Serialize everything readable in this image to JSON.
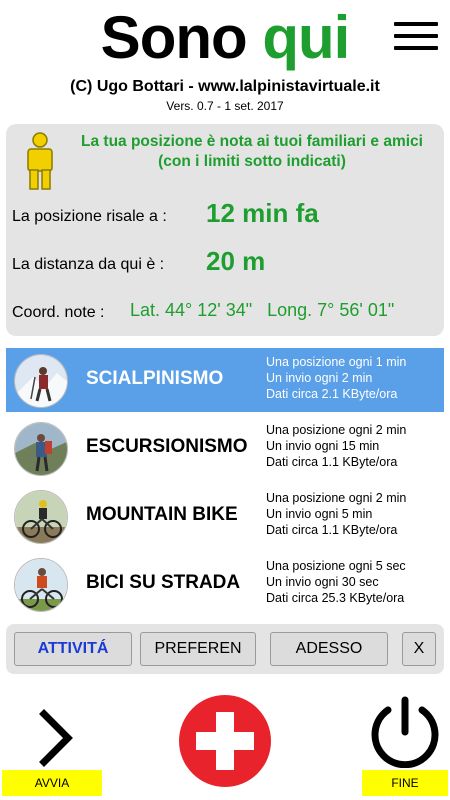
{
  "header": {
    "title_part1": "Sono",
    "title_part2": "qui",
    "credit": "(C) Ugo Bottari - www.lalpinistavirtuale.it",
    "version": "Vers. 0.7 - 1 set. 2017"
  },
  "status": {
    "notice_line1": "La tua posizione è nota ai tuoi familiari e amici",
    "notice_line2": "(con i limiti sotto indicati)",
    "age_label": "La posizione risale a :",
    "age_value": "12 min fa",
    "distance_label": "La distanza da qui è :",
    "distance_value": "20 m",
    "coord_label": "Coord. note :",
    "coord_value": "Lat. 44° 12' 34\"   Long. 7° 56' 01\""
  },
  "activities": [
    {
      "name": "SCIALPINISMO",
      "line1": "Una posizione ogni 1 min",
      "line2": "Un invio ogni 2 min",
      "line3": "Dati circa 2.1 KByte/ora",
      "selected": true
    },
    {
      "name": "ESCURSIONISMO",
      "line1": "Una posizione ogni 2 min",
      "line2": "Un invio ogni 15 min",
      "line3": "Dati circa 1.1 KByte/ora",
      "selected": false
    },
    {
      "name": "MOUNTAIN BIKE",
      "line1": "Una posizione ogni 2 min",
      "line2": "Un invio ogni 5 min",
      "line3": "Dati circa 1.1 KByte/ora",
      "selected": false
    },
    {
      "name": "BICI SU STRADA",
      "line1": "Una posizione ogni 5 sec",
      "line2": "Un invio ogni 30 sec",
      "line3": "Dati circa 25.3 KByte/ora",
      "selected": false
    }
  ],
  "tabs": {
    "activity": "ATTIVITÁ",
    "preferences": "PREFEREN",
    "now": "ADESSO",
    "close": "X"
  },
  "bottom": {
    "start_label": "AVVIA",
    "end_label": "FINE"
  },
  "icons": {
    "menu": "hamburger-menu-icon",
    "person": "person-icon",
    "start": "chevron-right-icon",
    "sos": "red-cross-icon",
    "end": "power-icon"
  },
  "colors": {
    "accent_green": "#1e9e2f",
    "selected_row": "#5aa0e8",
    "active_tab": "#1a3bd6",
    "sos_red": "#e8232c",
    "label_yellow": "#ffff00"
  }
}
